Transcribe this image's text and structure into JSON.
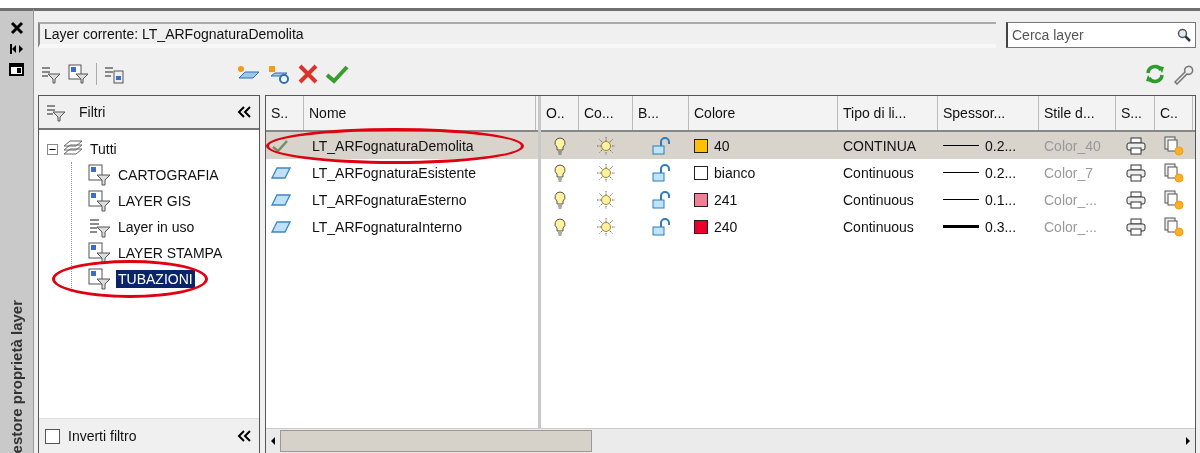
{
  "side_strip": {
    "title": "estore proprietà layer"
  },
  "current_layer": "Layer corrente: LT_ARFognaturaDemolita",
  "search": {
    "placeholder": "Cerca layer"
  },
  "filters": {
    "title": "Filtri",
    "tree": [
      {
        "label": "Tutti",
        "kind": "all",
        "expanded": true,
        "selected": false,
        "circled": false,
        "children": [
          {
            "label": "CARTOGRAFIA",
            "kind": "group",
            "selected": false,
            "circled": false
          },
          {
            "label": "LAYER GIS",
            "kind": "group",
            "selected": false,
            "circled": false
          },
          {
            "label": "Layer in uso",
            "kind": "property",
            "selected": false,
            "circled": false
          },
          {
            "label": "LAYER STAMPA",
            "kind": "group",
            "selected": false,
            "circled": false
          },
          {
            "label": "TUBAZIONI",
            "kind": "group",
            "selected": true,
            "circled": true
          }
        ]
      }
    ],
    "invert": {
      "label": "Inverti filtro",
      "checked": false
    }
  },
  "columns_left": [
    "S..",
    "Nome"
  ],
  "columns_right": [
    "O..",
    "Co...",
    "B...",
    "Colore",
    "Tipo di li...",
    "Spessor...",
    "Stile d...",
    "S...",
    "C.."
  ],
  "layers": [
    {
      "current": true,
      "selected": true,
      "circled": true,
      "name": "LT_ARFognaturaDemolita",
      "on": true,
      "frozen": false,
      "locked": false,
      "color": "#ffc000",
      "color_name": "40",
      "linetype": "CONTINUA",
      "heavy": false,
      "lineweight": "0.2...",
      "plot_style": "Color_40"
    },
    {
      "current": false,
      "selected": false,
      "circled": false,
      "name": "LT_ARFognaturaEsistente",
      "on": true,
      "frozen": false,
      "locked": false,
      "color": "#ffffff",
      "color_name": "bianco",
      "linetype": "Continuous",
      "heavy": false,
      "lineweight": "0.2...",
      "plot_style": "Color_7"
    },
    {
      "current": false,
      "selected": false,
      "circled": false,
      "name": "LT_ARFognaturaEsterno",
      "on": true,
      "frozen": false,
      "locked": false,
      "color": "#f07f94",
      "color_name": "241",
      "linetype": "Continuous",
      "heavy": false,
      "lineweight": "0.1...",
      "plot_style": "Color_..."
    },
    {
      "current": false,
      "selected": false,
      "circled": false,
      "name": "LT_ARFognaturaInterno",
      "on": true,
      "frozen": false,
      "locked": false,
      "color": "#e8002a",
      "color_name": "240",
      "linetype": "Continuous",
      "heavy": true,
      "lineweight": "0.3...",
      "plot_style": "Color_..."
    }
  ]
}
